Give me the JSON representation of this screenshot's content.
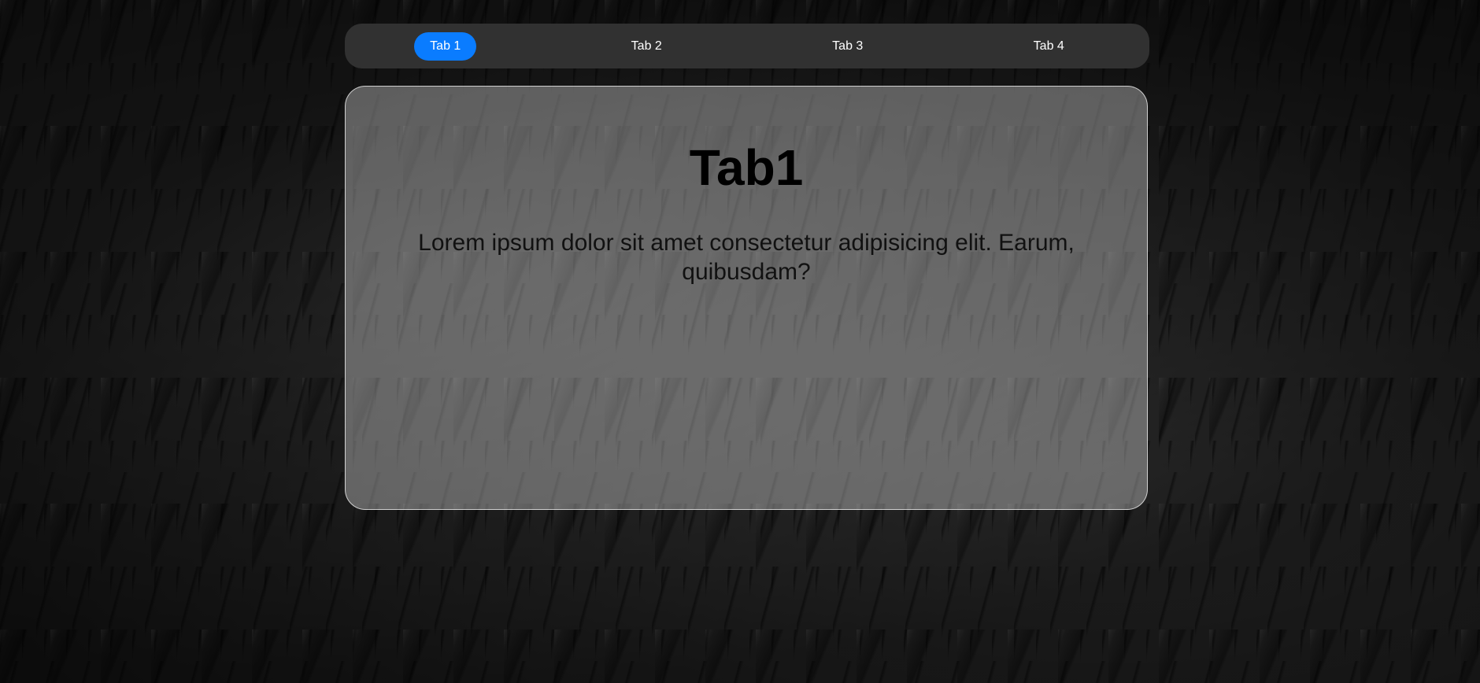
{
  "tabs": [
    {
      "label": "Tab 1",
      "active": true
    },
    {
      "label": "Tab 2",
      "active": false
    },
    {
      "label": "Tab 3",
      "active": false
    },
    {
      "label": "Tab 4",
      "active": false
    }
  ],
  "content": {
    "title": "Tab1",
    "body": "Lorem ipsum dolor sit amet consectetur adipisicing elit. Earum, quibusdam?"
  },
  "colors": {
    "active_tab": "#0a7cff",
    "tabbar_bg": "#313131"
  }
}
